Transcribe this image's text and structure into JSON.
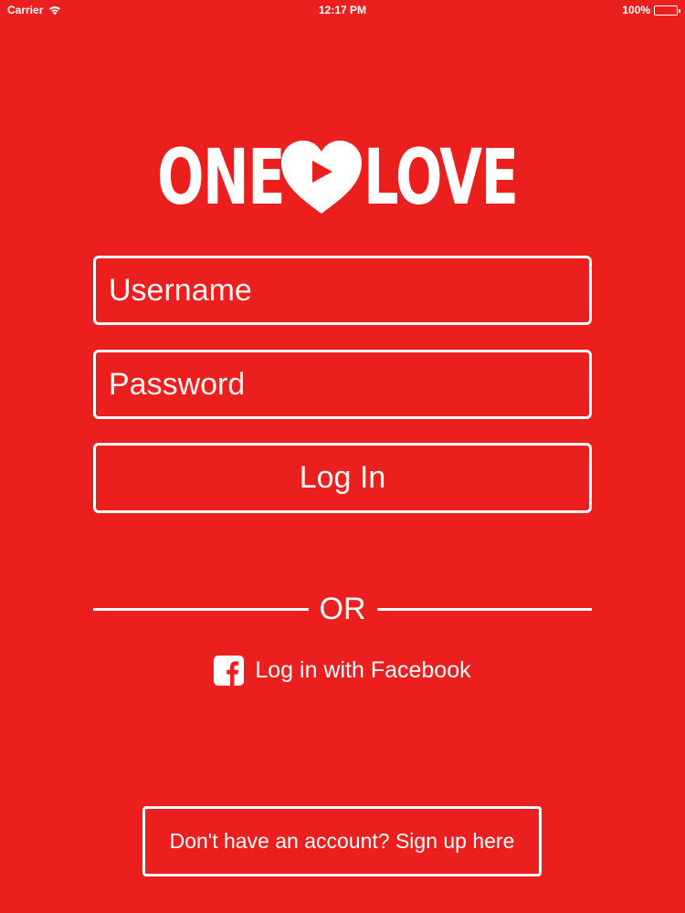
{
  "status_bar": {
    "carrier": "Carrier",
    "time": "12:17 PM",
    "battery": "100%"
  },
  "logo": {
    "word_left": "ONE",
    "word_right": "LOVE",
    "icon": "heart-play-icon"
  },
  "form": {
    "username_placeholder": "Username",
    "password_placeholder": "Password",
    "login_label": "Log In"
  },
  "divider": {
    "label": "OR"
  },
  "facebook": {
    "label": "Log in with Facebook",
    "icon": "facebook-icon"
  },
  "signup": {
    "label": "Don't have an account? Sign up here"
  },
  "colors": {
    "background": "#ec1f1f",
    "foreground": "#ffffff"
  }
}
